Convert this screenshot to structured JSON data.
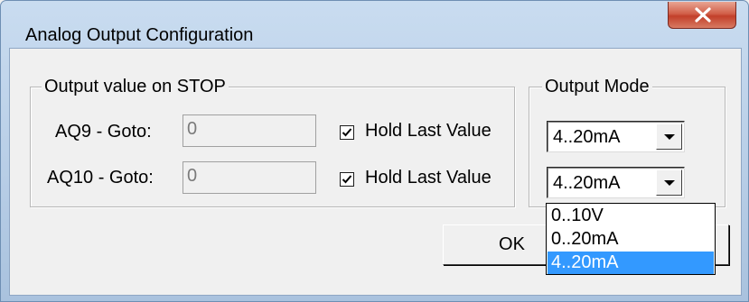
{
  "window": {
    "title": "Analog Output Configuration"
  },
  "output_value_on_stop": {
    "legend": "Output value on STOP",
    "rows": [
      {
        "label": "AQ9 - Goto:",
        "value": "0",
        "hold_label": "Hold Last Value",
        "hold_checked": true
      },
      {
        "label": "AQ10 - Goto:",
        "value": "0",
        "hold_label": "Hold Last Value",
        "hold_checked": true
      }
    ]
  },
  "output_mode": {
    "legend": "Output Mode",
    "combos": [
      {
        "value": "4..20mA"
      },
      {
        "value": "4..20mA",
        "open": true
      }
    ],
    "options": [
      "0..10V",
      "0..20mA",
      "4..20mA"
    ],
    "highlighted_option": "4..20mA"
  },
  "buttons": {
    "ok_label": "OK",
    "partial_label": ""
  },
  "icons": {
    "close": "close-icon",
    "check": "checkmark-icon",
    "dropdown": "chevron-down-icon"
  },
  "colors": {
    "highlight": "#3399ff",
    "close_button": "#c23f2a"
  }
}
